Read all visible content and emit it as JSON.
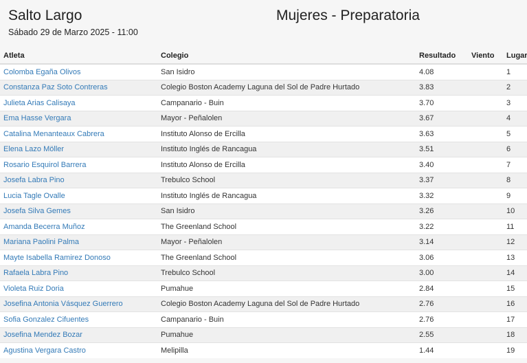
{
  "header": {
    "event": "Salto Largo",
    "category": "Mujeres - Preparatoria",
    "date": "Sábado 29 de Marzo 2025 - 11:00"
  },
  "table": {
    "columns": {
      "atleta": "Atleta",
      "colegio": "Colegio",
      "resultado": "Resultado",
      "viento": "Viento",
      "lugar": "Lugar"
    },
    "rows": [
      {
        "atleta": "Colomba Egaña Olivos",
        "colegio": "San Isidro",
        "resultado": "4.08",
        "viento": "",
        "lugar": "1"
      },
      {
        "atleta": "Constanza Paz Soto Contreras",
        "colegio": "Colegio Boston Academy Laguna del Sol de Padre Hurtado",
        "resultado": "3.83",
        "viento": "",
        "lugar": "2"
      },
      {
        "atleta": "Julieta Arias Calisaya",
        "colegio": "Campanario - Buin",
        "resultado": "3.70",
        "viento": "",
        "lugar": "3"
      },
      {
        "atleta": "Ema Hasse Vergara",
        "colegio": "Mayor - Peñalolen",
        "resultado": "3.67",
        "viento": "",
        "lugar": "4"
      },
      {
        "atleta": "Catalina Menanteaux Cabrera",
        "colegio": "Instituto Alonso de Ercilla",
        "resultado": "3.63",
        "viento": "",
        "lugar": "5"
      },
      {
        "atleta": "Elena Lazo Möller",
        "colegio": "Instituto Inglés de Rancagua",
        "resultado": "3.51",
        "viento": "",
        "lugar": "6"
      },
      {
        "atleta": "Rosario Esquirol Barrera",
        "colegio": "Instituto Alonso de Ercilla",
        "resultado": "3.40",
        "viento": "",
        "lugar": "7"
      },
      {
        "atleta": "Josefa Labra Pino",
        "colegio": "Trebulco School",
        "resultado": "3.37",
        "viento": "",
        "lugar": "8"
      },
      {
        "atleta": "Lucia Tagle Ovalle",
        "colegio": "Instituto Inglés de Rancagua",
        "resultado": "3.32",
        "viento": "",
        "lugar": "9"
      },
      {
        "atleta": "Josefa Silva Gemes",
        "colegio": "San Isidro",
        "resultado": "3.26",
        "viento": "",
        "lugar": "10"
      },
      {
        "atleta": "Amanda Becerra Muñoz",
        "colegio": "The Greenland School",
        "resultado": "3.22",
        "viento": "",
        "lugar": "11"
      },
      {
        "atleta": "Mariana Paolini Palma",
        "colegio": "Mayor - Peñalolen",
        "resultado": "3.14",
        "viento": "",
        "lugar": "12"
      },
      {
        "atleta": "Mayte Isabella Ramirez Donoso",
        "colegio": "The Greenland School",
        "resultado": "3.06",
        "viento": "",
        "lugar": "13"
      },
      {
        "atleta": "Rafaela Labra Pino",
        "colegio": "Trebulco School",
        "resultado": "3.00",
        "viento": "",
        "lugar": "14"
      },
      {
        "atleta": "Violeta Ruiz Doria",
        "colegio": "Pumahue",
        "resultado": "2.84",
        "viento": "",
        "lugar": "15"
      },
      {
        "atleta": "Josefina Antonia Vásquez Guerrero",
        "colegio": "Colegio Boston Academy Laguna del Sol de Padre Hurtado",
        "resultado": "2.76",
        "viento": "",
        "lugar": "16"
      },
      {
        "atleta": "Sofia Gonzalez Cifuentes",
        "colegio": "Campanario - Buin",
        "resultado": "2.76",
        "viento": "",
        "lugar": "17"
      },
      {
        "atleta": "Josefina Mendez Bozar",
        "colegio": "Pumahue",
        "resultado": "2.55",
        "viento": "",
        "lugar": "18"
      },
      {
        "atleta": "Agustina Vergara Castro",
        "colegio": "Melipilla",
        "resultado": "1.44",
        "viento": "",
        "lugar": "19"
      }
    ]
  },
  "colors": {
    "link": "#337ab7",
    "row_alt": "#f0f0f0",
    "background": "#f6f6f6"
  }
}
